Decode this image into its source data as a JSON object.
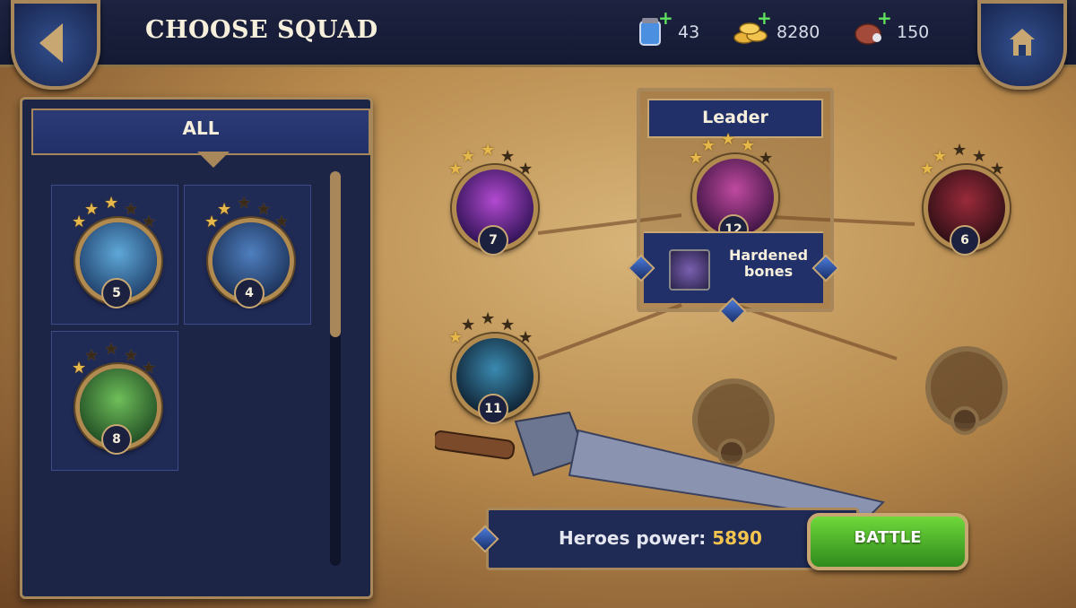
{
  "header": {
    "title": "CHOOSE SQUAD",
    "resources": [
      {
        "icon": "potion-jar-icon",
        "value": "43"
      },
      {
        "icon": "gold-coins-icon",
        "value": "8280"
      },
      {
        "icon": "raw-meat-icon",
        "value": "150"
      }
    ]
  },
  "filter": {
    "label": "ALL"
  },
  "roster": [
    {
      "level": "5",
      "stars": 3,
      "portrait": "blue-paladin"
    },
    {
      "level": "4",
      "stars": 2,
      "portrait": "noble-man"
    },
    {
      "level": "8",
      "stars": 1,
      "portrait": "elf-archer"
    }
  ],
  "squad": {
    "leader_label": "Leader",
    "leader": {
      "level": "12",
      "stars": 4,
      "portrait": "hooded-skeleton"
    },
    "leader_skill": "Hardened bones",
    "members": [
      {
        "level": "7",
        "stars": 3,
        "portrait": "purple-knight"
      },
      {
        "level": "6",
        "stars": 2,
        "portrait": "horned-dark-knight"
      },
      {
        "level": "11",
        "stars": 1,
        "portrait": "undead-king"
      }
    ]
  },
  "footer": {
    "power_label": "Heroes power:",
    "power_value": "5890",
    "battle_label": "BATTLE"
  },
  "colors": {
    "accent_gold": "#a8875a",
    "panel_blue": "#1f2a55",
    "battle_green": "#4caf2a",
    "power_value": "#f2c44f"
  }
}
